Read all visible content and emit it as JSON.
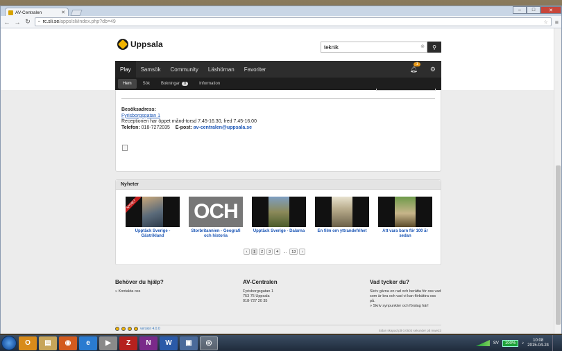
{
  "browser": {
    "tab_title": "AV-Centralen",
    "url_domain": "rc.sli.se",
    "url_path": "/apps/sli/index.php?db=49"
  },
  "site": {
    "logo_text": "Uppsala",
    "search_value": "teknik",
    "main_nav": [
      "Play",
      "Samsök",
      "Community",
      "Läshörnan",
      "Favoriter"
    ],
    "notification_count": "1",
    "sub_nav": {
      "hem": "Hem",
      "sok": "Sök",
      "bokningar": "Bokningar",
      "bokningar_count": "0",
      "information": "Information"
    }
  },
  "contact": {
    "visit_label": "Besöksadress:",
    "address_link": "Fyrisborgsgatan 1",
    "hours": "Receptionen har öppet månd-torsd 7.45-16.30, fred 7.45-16.00",
    "phone_label": "Telefon:",
    "phone": "018-7272035",
    "email_label": "E-post:",
    "email": "av-centralen@uppsala.se"
  },
  "news": {
    "heading": "Nyheter",
    "items": [
      {
        "title": "Upptäck Sverige - Gästrikland",
        "ribbon": "NYHET"
      },
      {
        "title": "Storbritannien - Geografi och historia",
        "overlay": "OCH"
      },
      {
        "title": "Upptäck Sverige - Dalarna"
      },
      {
        "title": "En film om yttrandefrihet"
      },
      {
        "title": "Att vara barn för 100 år sedan"
      }
    ],
    "pager": [
      "‹",
      "1",
      "2",
      "3",
      "4",
      "...",
      "13",
      "›"
    ]
  },
  "footer": {
    "help_heading": "Behöver du hjälp?",
    "help_link": "» Kontakta oss",
    "org_heading": "AV-Centralen",
    "org_street": "Fyrisborgsgatan 1",
    "org_city": "753 75 Uppsala",
    "org_phone": "018-727 20 35",
    "feedback_heading": "Vad tycker du?",
    "feedback_text": "Skriv gärna en rad och berätta för oss vad som är bra och vad vi kan förbättra oss på.",
    "feedback_link": "» Skriv synpunkter och förslag här!",
    "version": "version 4.0.0",
    "gen_time": "Sidan skapad på 0.0503 sekunder på mwe23"
  },
  "taskbar": {
    "lang": "SV",
    "battery": "100%",
    "time": "10:08",
    "date": "2015-04-24"
  }
}
